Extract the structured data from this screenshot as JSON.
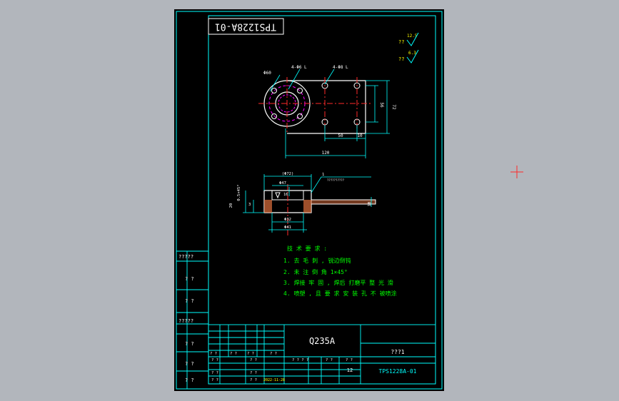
{
  "viewport": {
    "background": "#b2b6bc",
    "sheet_background": "#000000"
  },
  "colors": {
    "frame": "#00ffff",
    "outline": "#ffffff",
    "dimension": "#00ffff",
    "centerline": "#ff2a2a",
    "hidden": "#ff00ff",
    "notes": "#00ff00",
    "hatch": "#d36a3a",
    "crosshair": "#ff2a2a"
  },
  "drawing_number_rotated": "TPS1228A-01",
  "roughness": {
    "general_label": "??",
    "general_value": "12.5",
    "other_label": "??",
    "other_value": "6.3"
  },
  "plan_view": {
    "circle_dia_label": "Φ60",
    "hole_callout_left": "4-Φ6 L",
    "hole_callout_right": "4-Φ8 L",
    "dim_56": "56",
    "dim_72": "72",
    "dim_50": "50",
    "dim_10": "10",
    "dim_120": "120"
  },
  "section_view": {
    "dim_phi72": "(Φ72)",
    "dim_phi47": "Φ47",
    "dim_16": "16",
    "dim_05": "0.5×45°",
    "dim_3": "3",
    "dim_phi32": "Φ32",
    "dim_phi41": "Φ41",
    "dim_20": "20",
    "dim_10": "10",
    "weld_note": "1",
    "weld_text": "??????????"
  },
  "tech_notes": {
    "title": "技 术 要 求 :",
    "lines": [
      "1. 去 毛 刺 , 锐边倒钝",
      "2. 未 注 倒 角 1×45°",
      "3. 焊接 牢 固 , 焊后 打磨平 整 光 滑",
      "4. 喷塑 , 且 要 求 安 装 孔 不 被喷涂"
    ]
  },
  "left_column": {
    "labels": [
      "?????",
      "? ?",
      "? ?",
      "?????",
      "? ?",
      "? ?",
      "? ?"
    ]
  },
  "title_block": {
    "material": "Q235A",
    "part_name": "???1",
    "drawing_no": "TPS1228A-01",
    "scale_value": "12",
    "date": "2022-11-28",
    "cells": {
      "r1c1": "? ?",
      "r1c2": "? ?",
      "r1c3": "? ?",
      "r1c4": "? ?",
      "r2c1": "? ?",
      "r2c2": "? ?",
      "r3c1": "? ?",
      "r3c2": "? ?",
      "mid1": "? ? ? ?",
      "mid2": "? ?",
      "mid3": "? ?",
      "r4c1": "? ?",
      "r4c2": "? ?"
    }
  }
}
